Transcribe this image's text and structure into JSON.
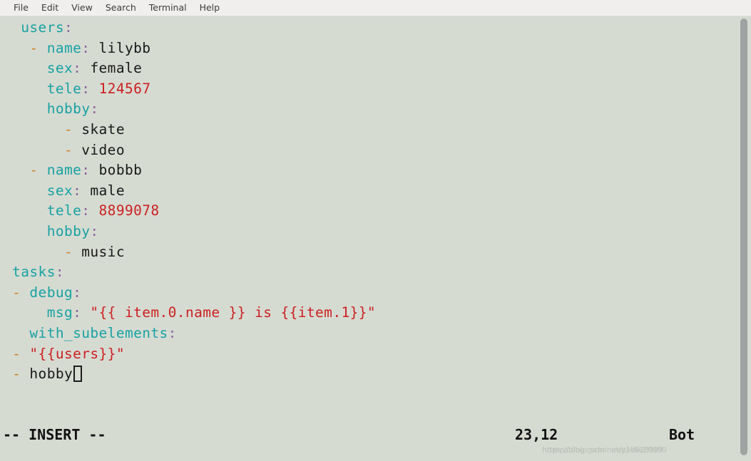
{
  "menubar": {
    "items": [
      {
        "label": "File",
        "name": "menu-file"
      },
      {
        "label": "Edit",
        "name": "menu-edit"
      },
      {
        "label": "View",
        "name": "menu-view"
      },
      {
        "label": "Search",
        "name": "menu-search"
      },
      {
        "label": "Terminal",
        "name": "menu-terminal"
      },
      {
        "label": "Help",
        "name": "menu-help"
      }
    ]
  },
  "editor": {
    "lines": [
      {
        "indent": "  ",
        "dash": "",
        "key": "users",
        "colon": ":",
        "value": "",
        "value_type": "none"
      },
      {
        "indent": "   ",
        "dash": "- ",
        "key": "name",
        "colon": ":",
        "value": " lilybb",
        "value_type": "plain"
      },
      {
        "indent": "     ",
        "dash": "",
        "key": "sex",
        "colon": ":",
        "value": " female",
        "value_type": "plain"
      },
      {
        "indent": "     ",
        "dash": "",
        "key": "tele",
        "colon": ":",
        "value": " 124567",
        "value_type": "number"
      },
      {
        "indent": "     ",
        "dash": "",
        "key": "hobby",
        "colon": ":",
        "value": "",
        "value_type": "none"
      },
      {
        "indent": "       ",
        "dash": "- ",
        "key": "",
        "colon": "",
        "value": "skate",
        "value_type": "plain"
      },
      {
        "indent": "       ",
        "dash": "- ",
        "key": "",
        "colon": "",
        "value": "video",
        "value_type": "plain"
      },
      {
        "indent": "   ",
        "dash": "- ",
        "key": "name",
        "colon": ":",
        "value": " bobbb",
        "value_type": "plain"
      },
      {
        "indent": "     ",
        "dash": "",
        "key": "sex",
        "colon": ":",
        "value": " male",
        "value_type": "plain"
      },
      {
        "indent": "     ",
        "dash": "",
        "key": "tele",
        "colon": ":",
        "value": " 8899078",
        "value_type": "number"
      },
      {
        "indent": "     ",
        "dash": "",
        "key": "hobby",
        "colon": ":",
        "value": "",
        "value_type": "none"
      },
      {
        "indent": "       ",
        "dash": "- ",
        "key": "",
        "colon": "",
        "value": "music",
        "value_type": "plain"
      },
      {
        "indent": " ",
        "dash": "",
        "key": "tasks",
        "colon": ":",
        "value": "",
        "value_type": "none"
      },
      {
        "indent": " ",
        "dash": "- ",
        "key": "debug",
        "colon": ":",
        "value": "",
        "value_type": "none"
      },
      {
        "indent": "     ",
        "dash": "",
        "key": "msg",
        "colon": ":",
        "value": " \"{{ item.0.name }} is {{item.1}}\"",
        "value_type": "string"
      },
      {
        "indent": "   ",
        "dash": "",
        "key": "with_subelements",
        "colon": ":",
        "value": "",
        "value_type": "none"
      },
      {
        "indent": " ",
        "dash": "- ",
        "key": "",
        "colon": "",
        "value": "\"{{users}}\"",
        "value_type": "string"
      },
      {
        "indent": " ",
        "dash": "- ",
        "key": "",
        "colon": "",
        "value": "hobby",
        "value_type": "plain",
        "cursor": true
      }
    ]
  },
  "status": {
    "mode": "-- INSERT --",
    "position": "23,12",
    "scroll": "Bot"
  },
  "watermark": {
    "text_a": "https://blog.csdn.net/y1s620909",
    "text_b": "https://blog.csdn.net/45620909"
  },
  "colors": {
    "terminal_bg": "#d6dbd2",
    "menubar_bg": "#f0efee",
    "key_teal": "#17a2a2",
    "colon_violet": "#8b5f9e",
    "dash_orange": "#d08024",
    "value_black": "#181818",
    "number_red": "#cc2020",
    "string_red": "#cc2020",
    "scrollbar_thumb": "#9fa2a0"
  }
}
